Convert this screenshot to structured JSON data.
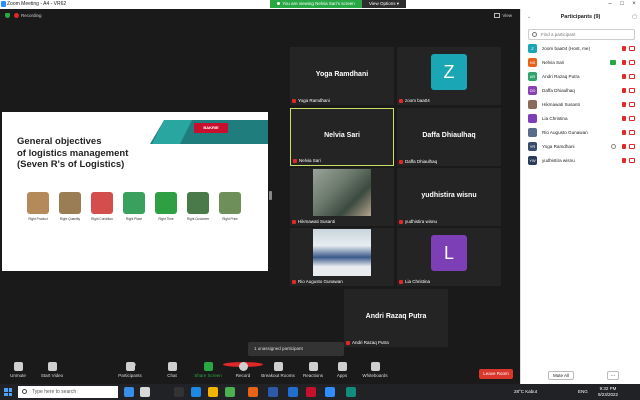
{
  "window": {
    "title": "Zoom Meeting - A4 - VR62"
  },
  "banner": {
    "sharing_text": "You are viewing Nelvia Sari's screen",
    "view_options": "View Options"
  },
  "meeting": {
    "recording_label": "Recording",
    "view_label": "View"
  },
  "slide": {
    "heading": "General objectives\nof logistics management\n(Seven R's of Logistics)",
    "logo": "BAKRIE",
    "rights": [
      {
        "label": "Right Product",
        "color": "#b48a5a"
      },
      {
        "label": "Right Quantity",
        "color": "#9a7d52"
      },
      {
        "label": "Right Condition",
        "color": "#d44e4e"
      },
      {
        "label": "Right Place",
        "color": "#3aa05e"
      },
      {
        "label": "Right Time",
        "color": "#2ea043"
      },
      {
        "label": "Right Customer",
        "color": "#4a7a4a"
      },
      {
        "label": "Right Price",
        "color": "#6f8f5a"
      }
    ]
  },
  "tiles": [
    {
      "name": "Yoga Ramdhani",
      "label": "Yoga Ramdhani",
      "kind": "name"
    },
    {
      "name": "",
      "label": "zoom baa04",
      "kind": "avatar",
      "initial": "Z",
      "color": "#1aa6b5"
    },
    {
      "name": "Nelvia Sari",
      "label": "Nelvia Sari",
      "kind": "name",
      "active": true
    },
    {
      "name": "Daffa Dhiaulhaq",
      "label": "Daffa Dhiaulhaq",
      "kind": "name"
    },
    {
      "name": "",
      "label": "Hikmawati Susanti",
      "kind": "photo"
    },
    {
      "name": "yudhistira wisnu",
      "label": "yudhistira wisnu",
      "kind": "name"
    },
    {
      "name": "",
      "label": "Rio Augusto Gunawan",
      "kind": "photo2"
    },
    {
      "name": "",
      "label": "Lia Christina",
      "kind": "avatar",
      "initial": "L",
      "color": "#7c3fb5"
    },
    {
      "name": "Andri Razaq Putra",
      "label": "Andri Razaq Putra",
      "kind": "name"
    }
  ],
  "toast": "1 unassigned participant",
  "toolbar": {
    "items": [
      "Unmute",
      "Start Video",
      "Participants",
      "Chat",
      "Share Screen",
      "Record",
      "Breakout Rooms",
      "Reactions",
      "Apps",
      "Whiteboards"
    ],
    "participant_count": "9",
    "leave": "Leave Room"
  },
  "panel": {
    "title": "Participants (9)",
    "search_placeholder": "Find a participant",
    "participants": [
      {
        "initials": "Z",
        "name": "zoom baa04 (Host, me)",
        "color": "#1aa6b5",
        "extra": "none"
      },
      {
        "initials": "NS",
        "name": "Nelvia Sari",
        "color": "#e8631a",
        "extra": "share"
      },
      {
        "initials": "AR",
        "name": "Andri Razaq Putra",
        "color": "#2ea36a",
        "extra": "none"
      },
      {
        "initials": "DD",
        "name": "Daffa Dhiaulhaq",
        "color": "#8a3fb5",
        "extra": "none"
      },
      {
        "initials": "",
        "name": "Hikmawati Susanti",
        "color": "#8a6a5a",
        "extra": "none"
      },
      {
        "initials": "",
        "name": "Lia Christina",
        "color": "#7c3fb5",
        "extra": "none"
      },
      {
        "initials": "",
        "name": "Rio Augusto Gunawan",
        "color": "#5a6a8a",
        "extra": "none"
      },
      {
        "initials": "YR",
        "name": "Yoga Ramdhani",
        "color": "#3a4a6a",
        "extra": "hand"
      },
      {
        "initials": "YW",
        "name": "yudhistira wisnu",
        "color": "#2a3a5a",
        "extra": "none"
      }
    ],
    "mute_all": "Mute All",
    "more": "..."
  },
  "taskbar": {
    "search_placeholder": "Type here to search",
    "weather": "28°C Kabut",
    "lang": "ENG",
    "time": "9:32 PM",
    "date": "9/23/2022"
  }
}
